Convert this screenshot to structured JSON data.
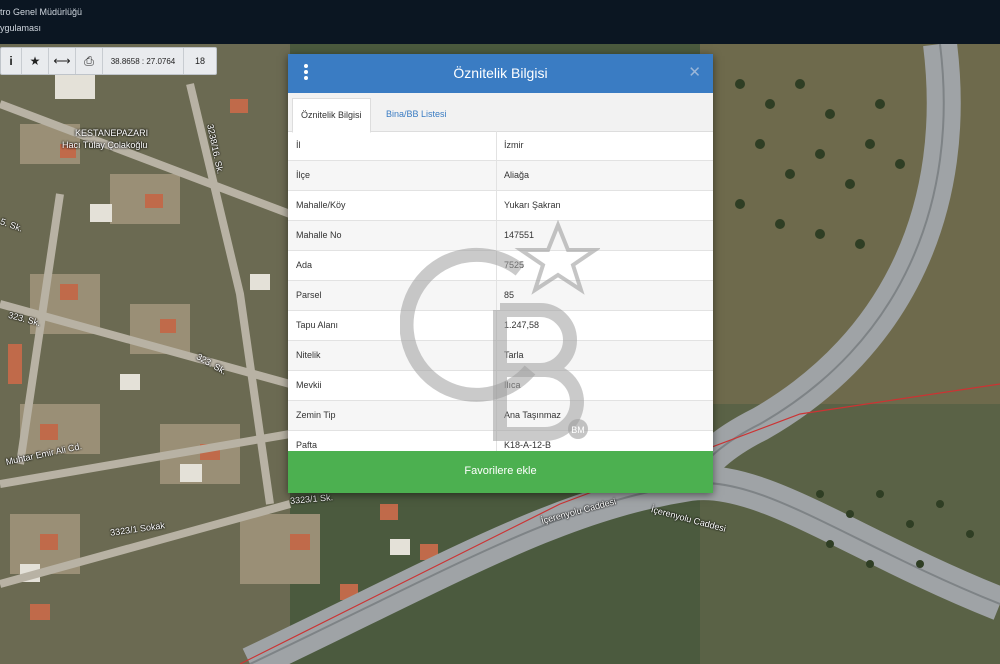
{
  "header": {
    "line1": "tro Genel Müdürlüğü",
    "line2": "ygulaması"
  },
  "toolbar": {
    "info_label": "i",
    "star_icon": "star-icon",
    "measure_icon": "arrows-icon",
    "print_icon": "printer-icon",
    "coordinates": "38.8658 : 27.0764",
    "zoom": "18"
  },
  "map_labels": {
    "neighborhood1": "KESTANEPAZARI",
    "neighborhood2": "Hacı Tülay Çolakoğlu",
    "street1": "3238/16. Sk.",
    "street2": "5. Sk.",
    "street3": "323. Sk.",
    "street4": "323. Sk.",
    "street5": "Muhtar Emir Ali Cd.",
    "street6": "3323/1 Sokak",
    "street7": "İçerenyolu Caddesi",
    "street8": "İçerenyolu Caddesi",
    "street9": "3323/1 Sk."
  },
  "dialog": {
    "title": "Öznitelik Bilgisi",
    "tabs": [
      "Öznitelik Bilgisi",
      "Bina/BB Listesi"
    ],
    "rows": [
      {
        "key": "İl",
        "value": "İzmir"
      },
      {
        "key": "İlçe",
        "value": "Aliağa"
      },
      {
        "key": "Mahalle/Köy",
        "value": "Yukarı Şakran"
      },
      {
        "key": "Mahalle No",
        "value": "147551"
      },
      {
        "key": "Ada",
        "value": "7525"
      },
      {
        "key": "Parsel",
        "value": "85"
      },
      {
        "key": "Tapu Alanı",
        "value": "1.247,58"
      },
      {
        "key": "Nitelik",
        "value": "Tarla"
      },
      {
        "key": "Mevkii",
        "value": "Ilıca"
      },
      {
        "key": "Zemin Tip",
        "value": "Ana Taşınmaz"
      },
      {
        "key": "Pafta",
        "value": "K18-A-12-B"
      }
    ],
    "favorite_button": "Favorilere ekle"
  },
  "watermark": {
    "badge": "BM"
  },
  "colors": {
    "header_blue": "#3a7cc3",
    "favorite_green": "#4cb050",
    "topbar": "#0b1622"
  }
}
